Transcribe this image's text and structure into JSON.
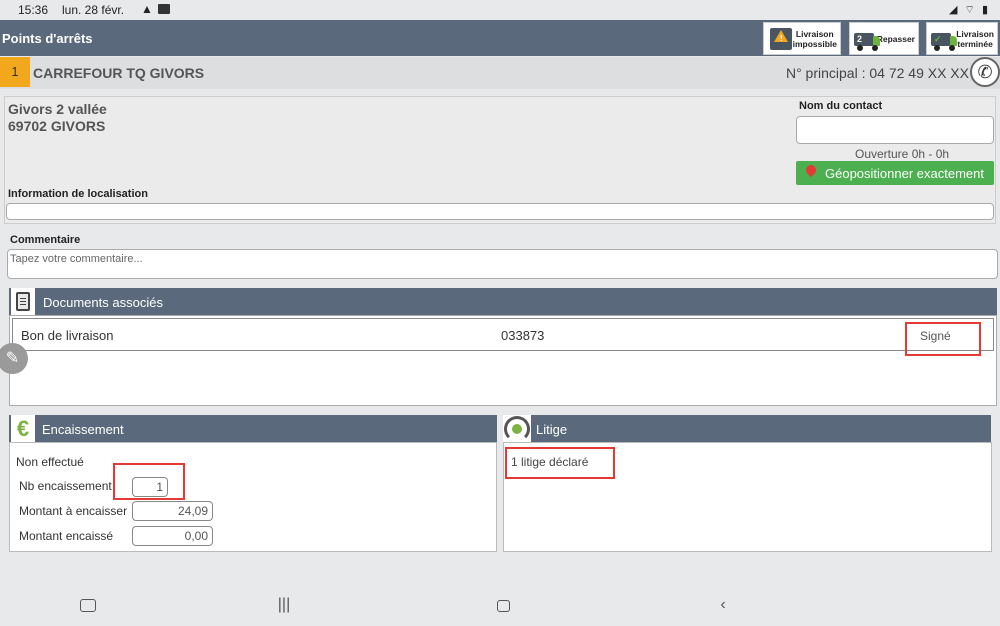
{
  "statusbar": {
    "time": "15:36",
    "date": "lun. 28 févr.",
    "system_icons": "◢ ⌔ ▮"
  },
  "topbar": {
    "title": "Points d'arrêts",
    "btn_impossible": "Livraison\nimpossible",
    "btn_repasser": "Repasser",
    "btn_repasser_num": "2",
    "btn_terminee": "Livraison\nterminée"
  },
  "stop": {
    "number": "1",
    "name": "CARREFOUR TQ GIVORS",
    "phone": "N° principal : 04 72 49 XX XX"
  },
  "address": {
    "line1": "Givors 2 vallée",
    "line2": "69702 GIVORS",
    "contact_label": "Nom du contact",
    "contact_value": "",
    "opening": "Ouverture 0h - 0h",
    "geo_button": "Géopositionner exactement",
    "location_label": "Information de localisation",
    "location_value": ""
  },
  "comment": {
    "label": "Commentaire",
    "placeholder": "Tapez votre commentaire..."
  },
  "documents": {
    "title": "Documents associés",
    "rows": [
      {
        "type": "Bon de livraison",
        "number": "033873",
        "status": "Signé"
      }
    ]
  },
  "encaissement": {
    "title": "Encaissement",
    "status": "Non effectué",
    "nb_label": "Nb encaissement",
    "nb_value": "1",
    "montant_label": "Montant à encaisser",
    "montant_value": "24,09",
    "encaisse_label": "Montant encaissé",
    "encaisse_value": "0,00"
  },
  "litige": {
    "title": "Litige",
    "text": "1 litige déclaré"
  },
  "colors": {
    "header": "#5a6a7c",
    "accent_orange": "#f2a81d",
    "geo_green": "#4caf50",
    "highlight_red": "#e53935"
  }
}
